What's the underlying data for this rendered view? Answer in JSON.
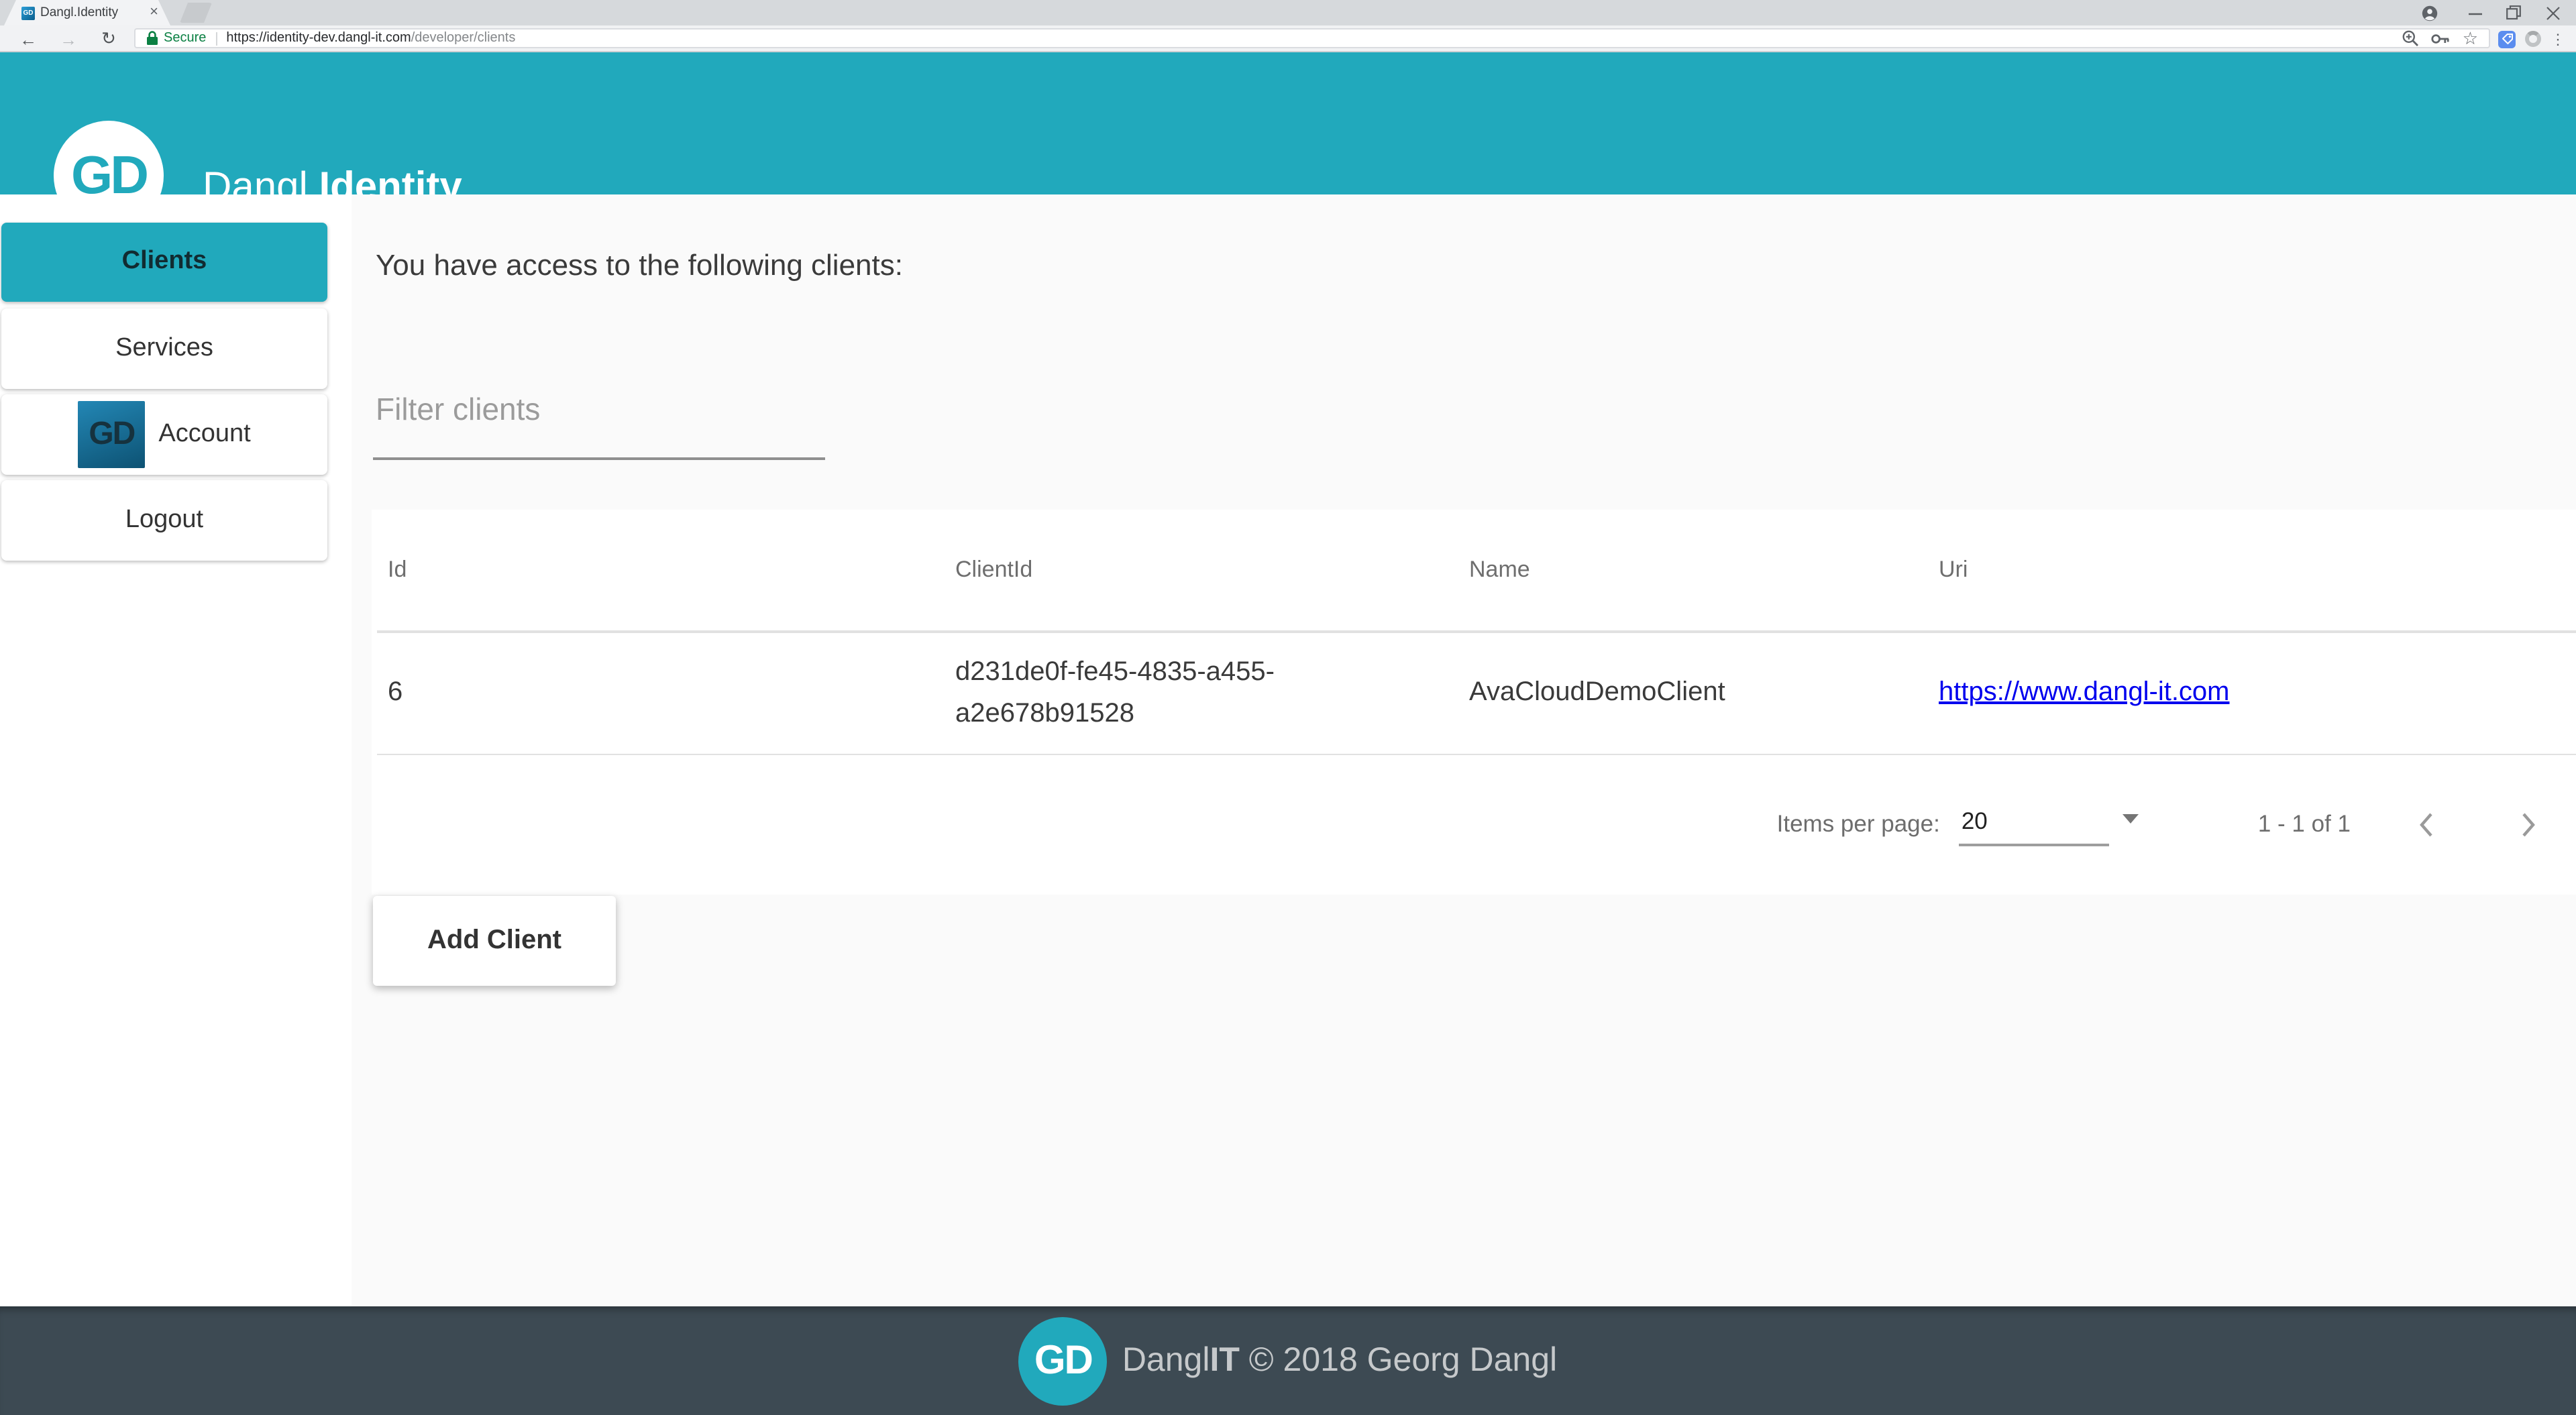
{
  "browser": {
    "tab": {
      "title": "Dangl.Identity",
      "favicon_text": "GD"
    },
    "address_bar": {
      "security_label": "Secure",
      "url_domain": "https://identity-dev.dangl-it.com",
      "url_path": "/developer/clients"
    }
  },
  "icons": {
    "back": "←",
    "forward": "→",
    "reload": "↻",
    "star": "☆",
    "overflow_menu": "⋮",
    "tab_close": "×",
    "dropdown_arrow": "▼"
  },
  "header": {
    "logo_text": "GD",
    "title_regular": "Dangl.",
    "title_bold": "Identity"
  },
  "sidebar": {
    "items": [
      {
        "label": "Clients"
      },
      {
        "label": "Services"
      },
      {
        "label": "Account",
        "icon_text": "GD"
      },
      {
        "label": "Logout"
      }
    ]
  },
  "main": {
    "heading": "You have access to the following clients:",
    "filter": {
      "placeholder": "Filter clients"
    },
    "table": {
      "columns": [
        "Id",
        "ClientId",
        "Name",
        "Uri"
      ],
      "rows": [
        {
          "id": "6",
          "client_id": "d231de0f-fe45-4835-a455-a2e678b91528",
          "name": "AvaCloudDemoClient",
          "uri": "https://www.dangl-it.com"
        }
      ]
    },
    "pagination": {
      "items_per_page_label": "Items per page:",
      "page_size": "20",
      "range_label": "1 - 1 of 1"
    },
    "add_button_label": "Add Client"
  },
  "footer": {
    "logo_text": "GD",
    "brand_regular": "Dangl",
    "brand_bold": "IT",
    "copyright_suffix": " © 2018 Georg Dangl"
  },
  "colors": {
    "accent_teal": "#21a9bc",
    "footer_bg": "#3d4a53",
    "link_blue": "#0000ee",
    "secure_green": "#0b8043",
    "page_bg": "#fafafa"
  }
}
